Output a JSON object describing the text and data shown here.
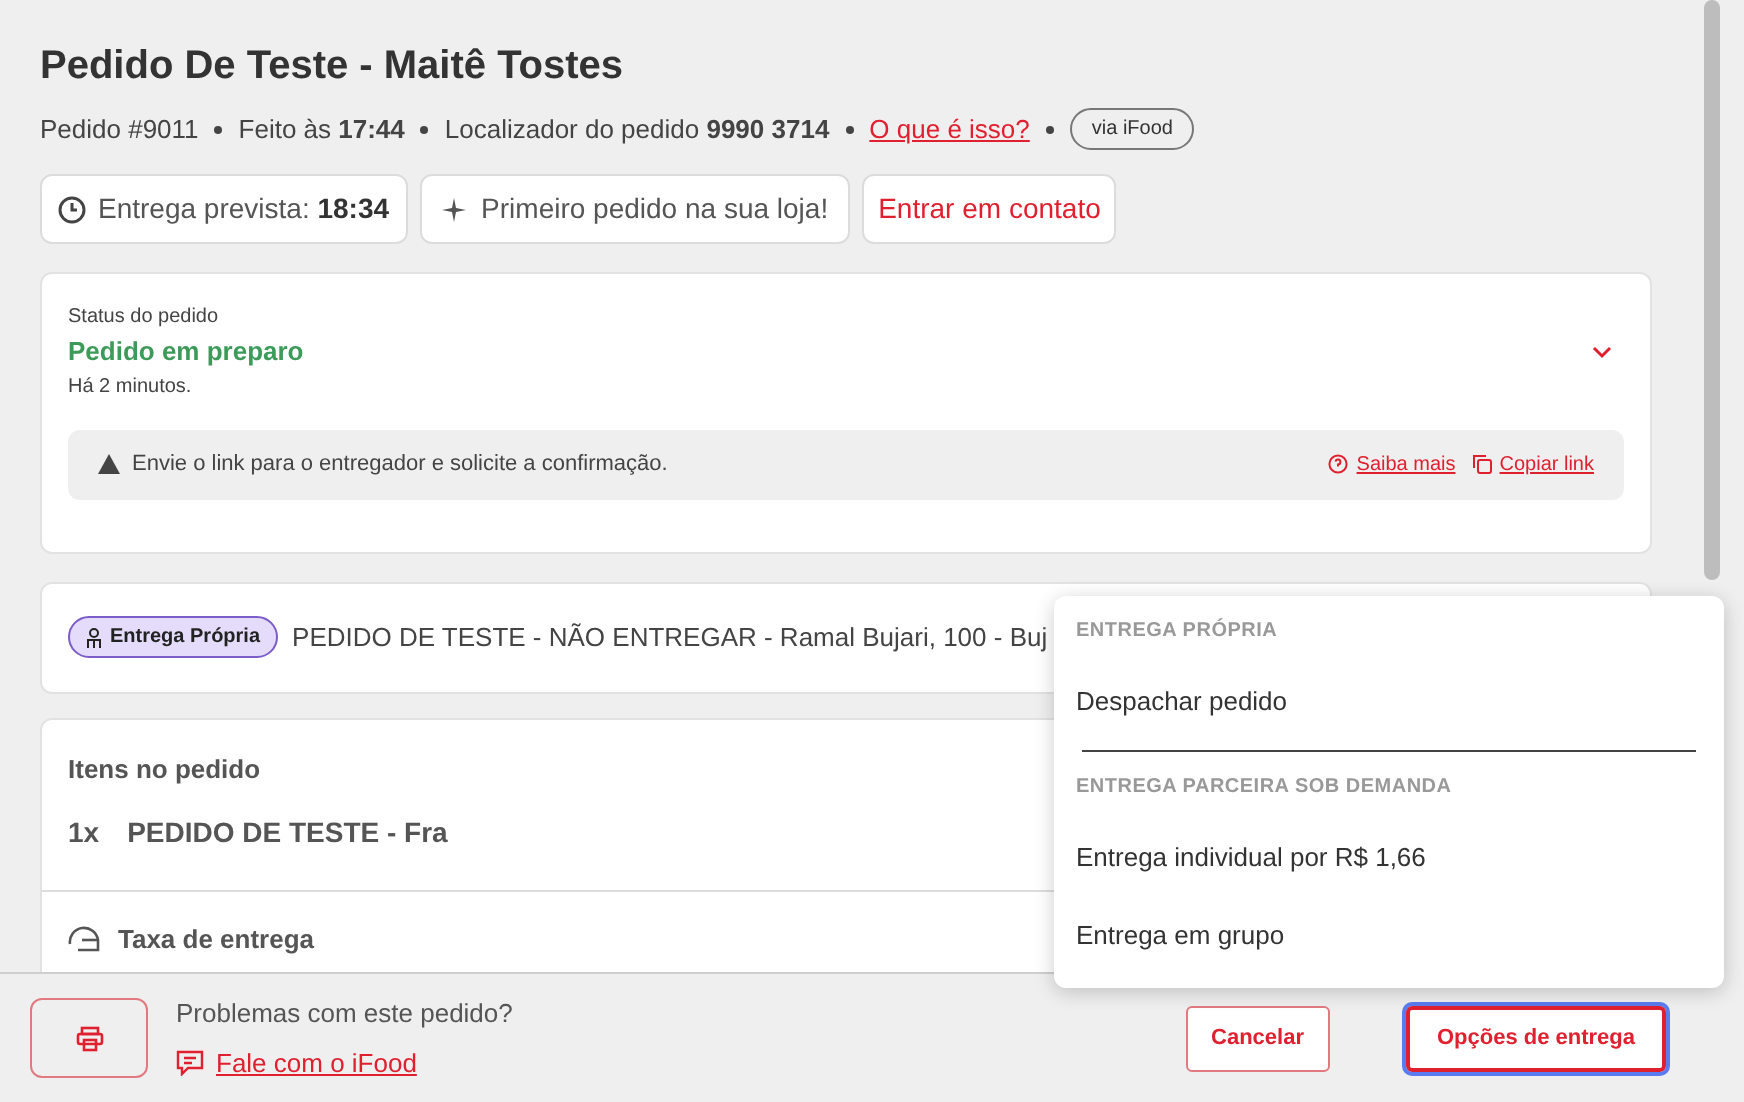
{
  "header": {
    "title": "Pedido De Teste - Maitê Tostes",
    "order_number": "Pedido #9011",
    "placed_label": "Feito às",
    "placed_time": "17:44",
    "locator_label": "Localizador do pedido",
    "locator": "9990 3714",
    "help_link": "O que é isso?",
    "channel_badge": "via iFood"
  },
  "chips": [
    {
      "kind": "clock",
      "label": "Entrega prevista:",
      "value": "18:34"
    },
    {
      "kind": "sparkle",
      "label": "Primeiro pedido na sua loja!"
    },
    {
      "kind": "link",
      "label": "Entrar em contato"
    }
  ],
  "status": {
    "caption": "Status do pedido",
    "value": "Pedido em preparo",
    "time": "Há 2 minutos.",
    "expanded": false,
    "notice": "Envie o link para o entregador e solicite a confirmação.",
    "learn_more": "Saiba mais",
    "copy_link": "Copiar link"
  },
  "delivery": {
    "badge": "Entrega Própria",
    "address": "PEDIDO DE TESTE - NÃO ENTREGAR - Ramal Bujari, 100 - Buj"
  },
  "items": {
    "title": "Itens no pedido",
    "rows": [
      {
        "qty": "1x",
        "name": "PEDIDO DE TESTE - Fra"
      }
    ],
    "fee_label": "Taxa de entrega"
  },
  "footer": {
    "question": "Problemas com este pedido?",
    "support_link": "Fale com o iFood",
    "cancel": "Cancelar",
    "options": "Opções de entrega"
  },
  "menu": {
    "sections": [
      {
        "heading": "ENTREGA PRÓPRIA",
        "items": [
          "Despachar pedido"
        ]
      },
      {
        "heading": "ENTREGA PARCEIRA SOB DEMANDA",
        "items": [
          "Entrega individual por R$ 1,66",
          "Entrega em grupo"
        ]
      }
    ]
  }
}
